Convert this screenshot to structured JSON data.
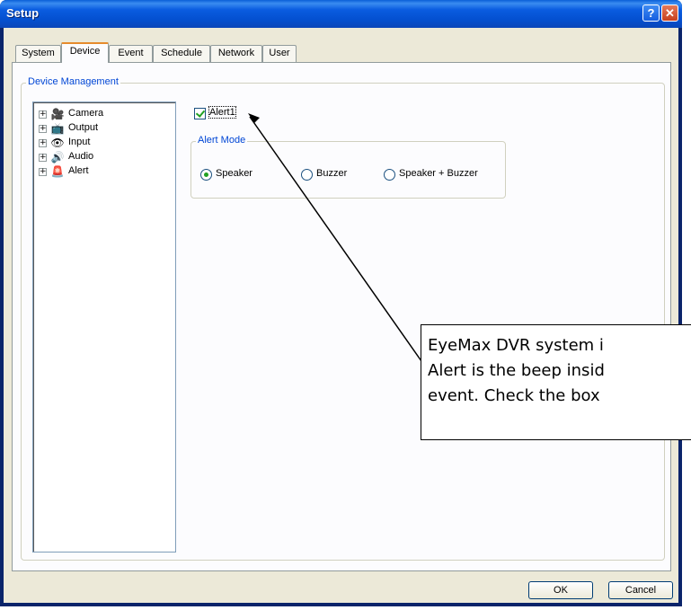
{
  "window": {
    "title": "Setup",
    "help_glyph": "?",
    "close_glyph": "✕"
  },
  "tabs": [
    {
      "label": "System",
      "active": false
    },
    {
      "label": "Device",
      "active": true
    },
    {
      "label": "Event",
      "active": false
    },
    {
      "label": "Schedule",
      "active": false
    },
    {
      "label": "Network",
      "active": false
    },
    {
      "label": "User",
      "active": false
    }
  ],
  "device_management": {
    "caption": "Device Management",
    "tree": [
      {
        "label": "Camera",
        "icon": "camera-icon",
        "glyph": "🎥",
        "expander": "+"
      },
      {
        "label": "Output",
        "icon": "output-icon",
        "glyph": "📺",
        "expander": "+"
      },
      {
        "label": "Input",
        "icon": "input-icon",
        "glyph": "👁",
        "expander": "+"
      },
      {
        "label": "Audio",
        "icon": "audio-icon",
        "glyph": "🔊",
        "expander": "+"
      },
      {
        "label": "Alert",
        "icon": "alert-icon",
        "glyph": "🚨",
        "expander": "+"
      }
    ]
  },
  "alert": {
    "checkbox_label": "Alert1",
    "checked": true,
    "mode_caption": "Alert Mode",
    "modes": [
      {
        "label": "Speaker",
        "selected": true
      },
      {
        "label": "Buzzer",
        "selected": false
      },
      {
        "label": "Speaker + Buzzer",
        "selected": false
      }
    ]
  },
  "buttons": {
    "ok": "OK",
    "cancel": "Cancel"
  },
  "callout": {
    "lines": [
      "EyeMax DVR system i",
      "Alert is the beep insid",
      "event. Check the box"
    ]
  },
  "colors": {
    "titlebar": "#0450d0",
    "dialog_bg": "#ece9d8",
    "group_caption": "#0046d5",
    "check_green": "#21a121"
  }
}
